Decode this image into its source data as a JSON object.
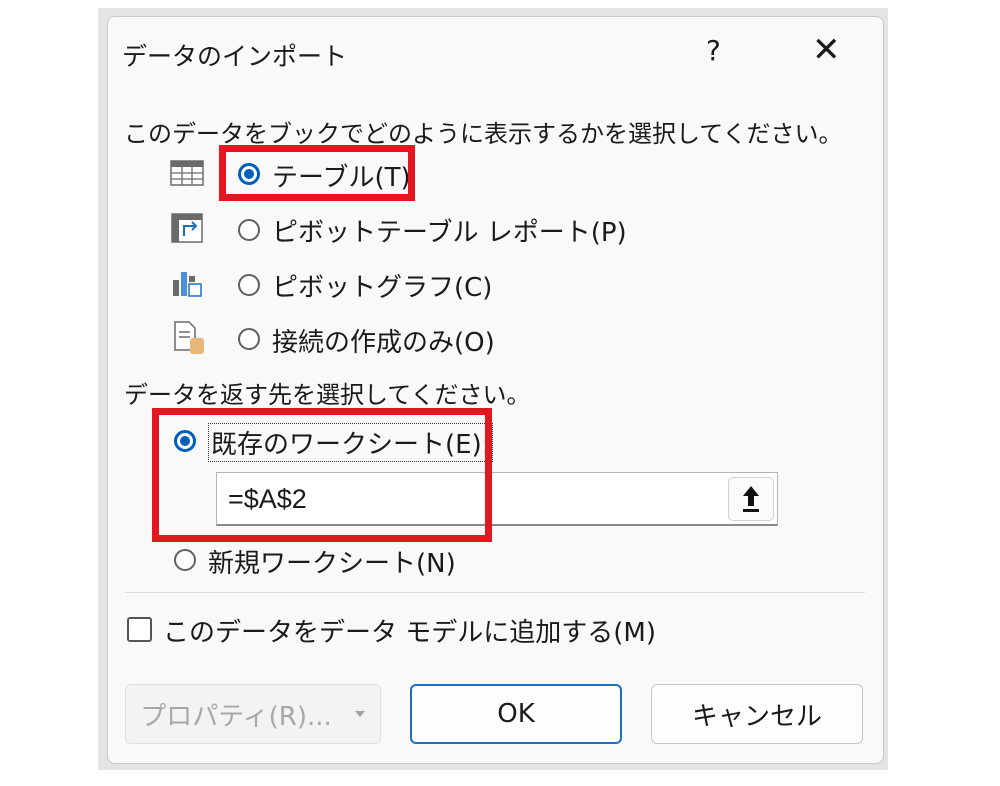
{
  "dialog": {
    "title": "データのインポート",
    "help_label": "?",
    "close_label": "✕"
  },
  "display_section": {
    "prompt": "このデータをブックでどのように表示するかを選択してください。",
    "options": [
      {
        "label": "テーブル(T)",
        "selected": true,
        "icon": "table-icon"
      },
      {
        "label": "ピボットテーブル レポート(P)",
        "selected": false,
        "icon": "pivot-table-icon"
      },
      {
        "label": "ピボットグラフ(C)",
        "selected": false,
        "icon": "pivot-chart-icon"
      },
      {
        "label": "接続の作成のみ(O)",
        "selected": false,
        "icon": "connection-only-icon"
      }
    ]
  },
  "destination_section": {
    "prompt": "データを返す先を選択してください。",
    "existing_sheet_label": "既存のワークシート(E):",
    "range_value": "=$A$2",
    "new_sheet_label": "新規ワークシート(N)",
    "selected": "existing"
  },
  "data_model": {
    "label": "このデータをデータ モデルに追加する(M)",
    "checked": false
  },
  "buttons": {
    "properties": "プロパティ(R)...",
    "ok": "OK",
    "cancel": "キャンセル"
  },
  "colors": {
    "accent": "#005fb8",
    "highlight": "#e3171e"
  }
}
